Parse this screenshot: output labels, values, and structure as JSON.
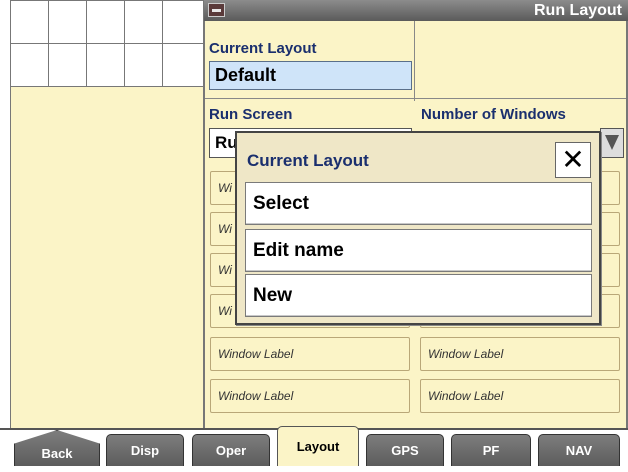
{
  "window": {
    "title": "Run Layout",
    "icon": "display-icon"
  },
  "current_layout": {
    "label": "Current Layout",
    "value": "Default"
  },
  "run_screen": {
    "label": "Run Screen",
    "value_visible": "Ru"
  },
  "number_of_windows": {
    "label": "Number of Windows"
  },
  "window_slots": {
    "partial_prefix": "Wi",
    "label": "Window Label"
  },
  "modal": {
    "title": "Current Layout",
    "close_icon": "close-icon",
    "items": [
      {
        "label": "Select"
      },
      {
        "label": "Edit name"
      },
      {
        "label": "New"
      }
    ]
  },
  "tabs": [
    {
      "label": "Back"
    },
    {
      "label": "Disp"
    },
    {
      "label": "Oper"
    },
    {
      "label": "Layout",
      "active": true
    },
    {
      "label": "GPS"
    },
    {
      "label": "PF"
    },
    {
      "label": "NAV"
    }
  ],
  "colors": {
    "panel_bg": "#fbf4c7",
    "label_blue": "#1a2f6e",
    "field_blue": "#cfe4f9",
    "titlebar_gray": "#6e6e6e"
  }
}
